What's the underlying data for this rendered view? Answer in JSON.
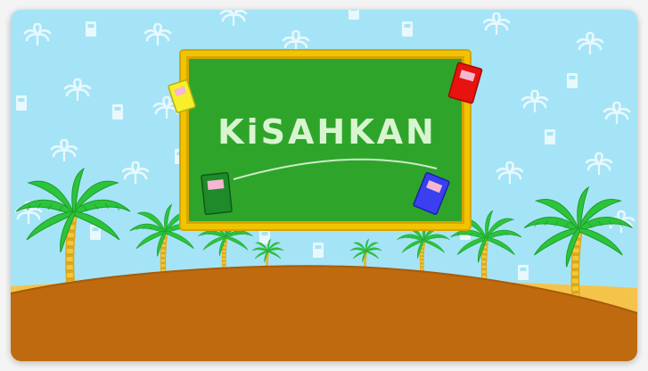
{
  "game": {
    "title": "KiSAHKAN"
  },
  "colors": {
    "sky": "#a5e4f6",
    "board_green": "#2ea52a",
    "board_frame": "#f0c400",
    "hill": "#c06a0f",
    "sand": "#f5c34a",
    "palm_leaf": "#2bc43a",
    "palm_trunk": "#f0c430",
    "chalk": "#e8f7e4"
  },
  "decorations": {
    "books": [
      {
        "name": "yellow-book",
        "color": "#f7ef2c"
      },
      {
        "name": "red-book",
        "color": "#e8120e"
      },
      {
        "name": "green-book",
        "color": "#1f8a2a"
      },
      {
        "name": "blue-book",
        "color": "#3a3ff0"
      }
    ]
  }
}
